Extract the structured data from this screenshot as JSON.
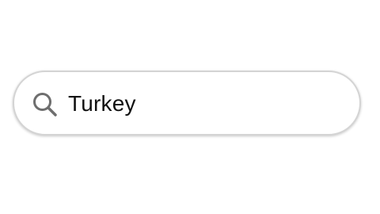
{
  "search": {
    "value": "Turkey",
    "icon": "search-icon"
  },
  "colors": {
    "background": "#ffffff",
    "border": "#d4d4d4",
    "icon": "#6e6e6e",
    "text": "#111111"
  }
}
